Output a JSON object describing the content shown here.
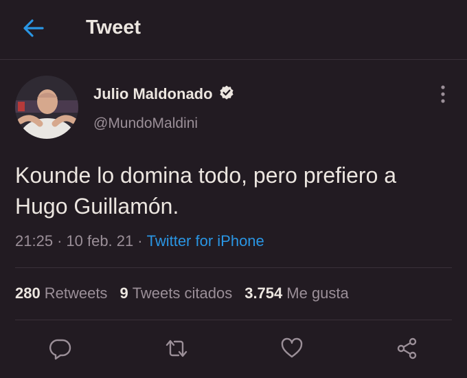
{
  "header": {
    "title": "Tweet"
  },
  "author": {
    "name": "Julio Maldonado",
    "handle": "@MundoMaldini"
  },
  "tweet": {
    "text": "Kounde lo domina todo, pero prefiero a Hugo Guillamón.",
    "time": "21:25",
    "date": "10 feb. 21",
    "source": "Twitter for iPhone",
    "separator": "·"
  },
  "stats": {
    "retweets_count": "280",
    "retweets_label": "Retweets",
    "quotes_count": "9",
    "quotes_label": "Tweets citados",
    "likes_count": "3.754",
    "likes_label": "Me gusta"
  },
  "colors": {
    "background": "#221b22",
    "accent": "#2a96e4",
    "text": "#ece6e0",
    "muted": "#9b8f98"
  },
  "icons": [
    "back-arrow-icon",
    "verified-badge-icon",
    "more-options-icon",
    "reply-icon",
    "retweet-icon",
    "like-icon",
    "share-icon"
  ]
}
